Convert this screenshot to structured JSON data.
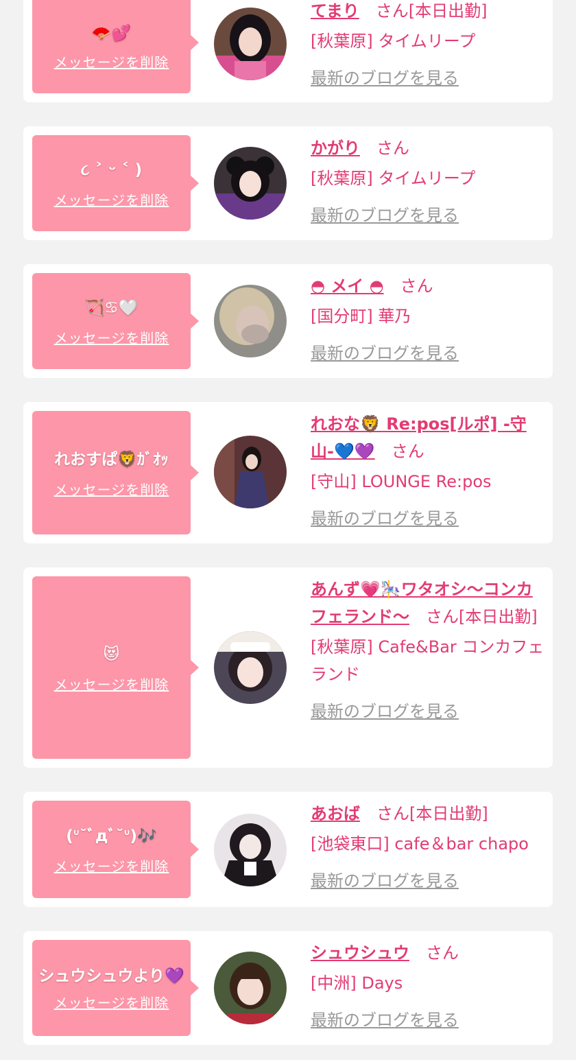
{
  "common": {
    "delete_label": "メッセージを削除",
    "honorific": "さん",
    "blog_link": "最新のブログを見る"
  },
  "colors": {
    "page_bg": "#f2f2f2",
    "card_bg": "#ffffff",
    "bubble_bg": "#fd96a8",
    "accent": "#e23b72",
    "link_gray": "#999999"
  },
  "items": [
    {
      "message": "🪭💕",
      "name": "てまり",
      "status": "[本日出勤]",
      "shop": "[秋葉原] タイムリープ",
      "avatar": "dark-hair-pink-kimono"
    },
    {
      "message": "૮ ˃ ᵕ ˂ )",
      "name": "かがり",
      "status": "",
      "shop": "[秋葉原] タイムリープ",
      "avatar": "twin-buns-purple-kimono"
    },
    {
      "message": "🏹♋🤍",
      "name": "◓ メイ ◓",
      "status": "",
      "shop": "[国分町] 華乃",
      "avatar": "blonde-blurred"
    },
    {
      "message": "れおすぱ🦁ｶﾞｵｯ",
      "name": "れおな🦁 Re:pos[ルポ] -守山-💙💜",
      "status": "",
      "shop": "[守山] LOUNGE Re:pos",
      "avatar": "dress-dark-room"
    },
    {
      "message": "😻",
      "name": "あんず💗🎠ワタオシ〜コンカフェランド〜",
      "status": "[本日出勤]",
      "shop": "[秋葉原] Cafe&Bar コンカフェランド",
      "avatar": "maid-headdress"
    },
    {
      "message": "(ᐡ˘ﾞдﾞ˘ᐡ)🎶",
      "name": "あおば",
      "status": "[本日出勤]",
      "shop": "[池袋東口] cafe＆bar chapo",
      "avatar": "gothic-lolita"
    },
    {
      "message": "シュウシュウより💜",
      "name": "シュウシュウ",
      "status": "",
      "shop": "[中洲] Days",
      "avatar": "smiling-bangs"
    }
  ]
}
